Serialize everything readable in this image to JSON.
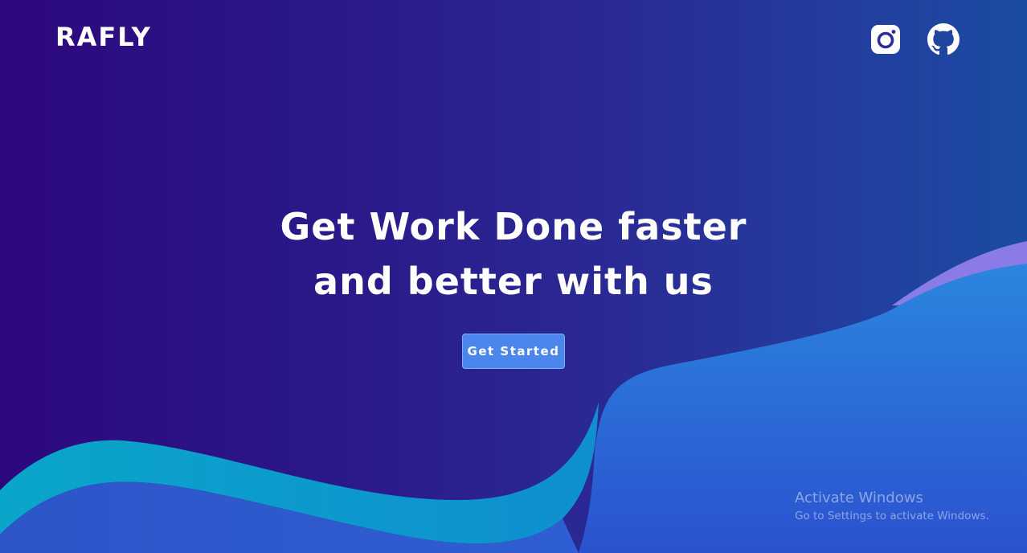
{
  "brand": {
    "name": "RAFLY"
  },
  "social": {
    "instagram_icon": "instagram-icon",
    "github_icon": "github-icon"
  },
  "hero": {
    "line1": "Get Work Done faster",
    "line2": "and better with us",
    "cta_label": "Get Started"
  },
  "colors": {
    "background_left": "#2c087d",
    "background_right": "#1b4ba3",
    "button": "#4a86ec",
    "wave_cyan": "#0aa2cf",
    "wave_blue": "#2a6fd8",
    "wave_purple": "#8a7be6"
  },
  "watermark": {
    "title": "Activate Windows",
    "subtitle": "Go to Settings to activate Windows."
  }
}
